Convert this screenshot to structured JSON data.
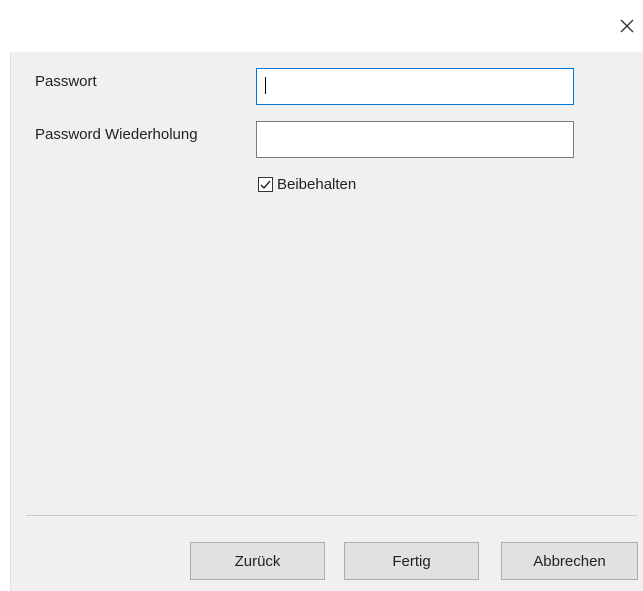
{
  "dialog": {
    "close_icon": "close-icon"
  },
  "form": {
    "password_label": "Passwort",
    "password_value": "",
    "repeat_label": "Password Wiederholung",
    "repeat_value": "",
    "keep_label": "Beibehalten",
    "keep_checked": true
  },
  "buttons": {
    "back_label": "Zurück",
    "finish_label": "Fertig",
    "cancel_label": "Abbrechen"
  },
  "colors": {
    "focus_border": "#0078d7",
    "content_bg": "#f0f0f0",
    "button_bg": "#e1e1e1"
  }
}
